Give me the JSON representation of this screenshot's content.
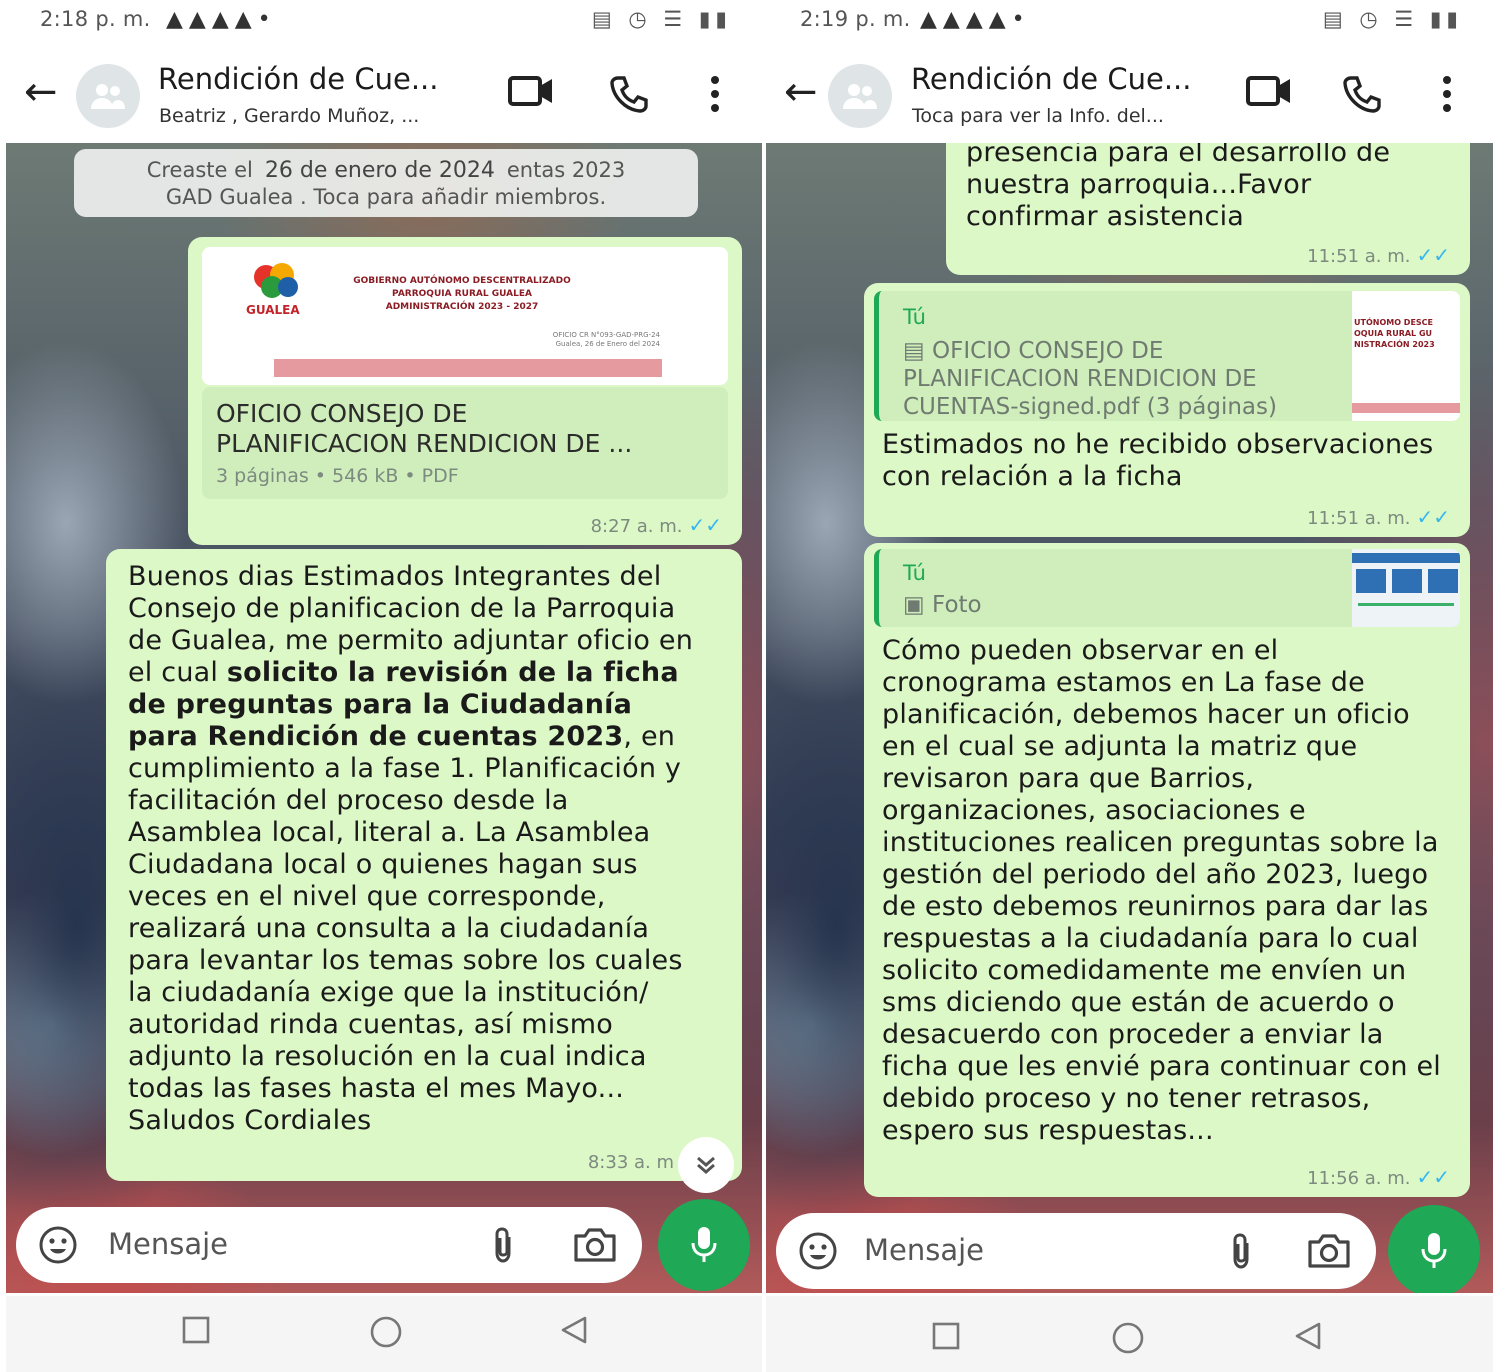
{
  "left": {
    "statusbar": {
      "time": "2:18 p. m."
    },
    "header": {
      "title": "Rendición de Cue...",
      "subtitle": "Beatriz , Gerardo Muñoz, ..."
    },
    "system_note": {
      "prefix": "Creaste el",
      "date": "26 de enero de 2024",
      "suffix": "entas 2023",
      "line2": "GAD Gualea . Toca para añadir miembros."
    },
    "document": {
      "preview": {
        "logo_text": "GUALEA",
        "line1": "GOBIERNO AUTÓNOMO DESCENTRALIZADO",
        "line2": "PARROQUIA RURAL GUALEA",
        "line3": "ADMINISTRACIÓN 2023 - 2027",
        "ref1": "OFICIO CR N°093-GAD-PRG-24",
        "ref2": "Gualea, 26 de Enero del 2024"
      },
      "title_line1": "OFICIO CONSEJO DE",
      "title_line2": "PLANIFICACION RENDICION DE ...",
      "info": "3 páginas • 546 kB • PDF",
      "time": "8:27 a. m."
    },
    "message": {
      "p1": "Buenos dias Estimados Integrantes del Consejo de planificacion de la Parroquia de Gualea, me permito adjuntar oficio en el cual ",
      "bold": "solicito la revisión de la ficha de preguntas para la Ciudadanía para Rendición de cuentas 2023",
      "p2": ", en cumplimiento a la fase 1. Planificación y facilitación del proceso desde la Asamblea local, literal a. La Asamblea Ciudadana local o quienes hagan sus veces en el nivel que corresponde, realizará una consulta a la ciudadanía para levantar los temas sobre los cuales la ciudadanía exige que la institución/ autoridad rinda cuentas, así mismo adjunto la resolución en la cual indica todas las fases hasta el mes Mayo... Saludos Cordiales",
      "time": "8:33 a. m"
    },
    "input": {
      "placeholder": "Mensaje"
    }
  },
  "right": {
    "statusbar": {
      "time": "2:19 p. m."
    },
    "header": {
      "title": "Rendición de Cue...",
      "subtitle": "Toca para ver la Info. del..."
    },
    "message1": {
      "text": "presencia para el desarrollo de nuestra parroquia...Favor confirmar asistencia",
      "time": "11:51 a. m."
    },
    "message2": {
      "quote_author": "Tú",
      "quote_text": "OFICIO CONSEJO DE PLANIFICACION RENDICION DE CUENTAS-signed.pdf (3 páginas)",
      "text": "Estimados no he recibido observaciones con relación a la ficha",
      "time": "11:51 a. m."
    },
    "message3": {
      "quote_author": "Tú",
      "quote_text": "Foto",
      "text": "Cómo pueden observar en el cronograma estamos en La fase de planificación, debemos hacer un oficio en el cual se adjunta la matriz que revisaron para que Barrios, organizaciones, asociaciones e instituciones realicen preguntas sobre la gestión del periodo del año 2023, luego de esto debemos reunirnos para dar las respuestas a la ciudadanía para lo cual solicito comedidamente me envíen un sms diciendo que están de acuerdo o desacuerdo con proceder a enviar la ficha que les envié para continuar con el debido proceso y no tener retrasos, espero sus respuestas...",
      "time": "11:56 a. m."
    },
    "input": {
      "placeholder": "Mensaje"
    }
  },
  "colors": {
    "bubble": "#dcf8c6",
    "accent": "#1fa855",
    "read_tick": "#34b7f1"
  }
}
